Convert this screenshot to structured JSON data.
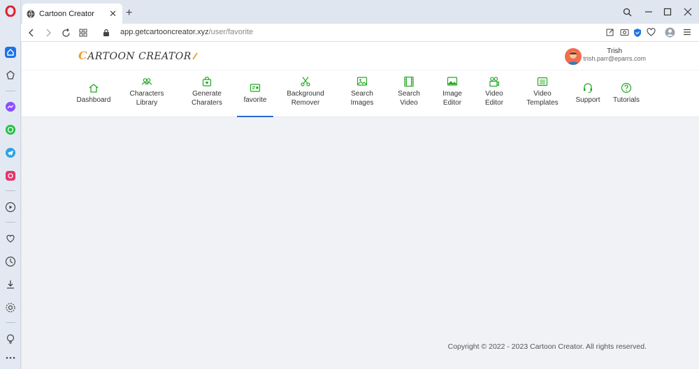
{
  "browser": {
    "tab_title": "Cartoon Creator",
    "url_domain": "app.getcartooncreator.xyz",
    "url_path": "/user/favorite"
  },
  "header": {
    "logo_first": "C",
    "logo_text": "ARTOON CREATOR",
    "user_name": "Trish",
    "user_email": "trish.parr@eparrs.com"
  },
  "nav": [
    {
      "label": "Dashboard",
      "icon": "home-icon"
    },
    {
      "label": "Characters\nLibrary",
      "icon": "users-icon"
    },
    {
      "label": "Generate\nCharaters",
      "icon": "bag-icon"
    },
    {
      "label": "favorite",
      "icon": "card-icon"
    },
    {
      "label": "Background\nRemover",
      "icon": "scissors-icon"
    },
    {
      "label": "Search\nImages",
      "icon": "image-icon"
    },
    {
      "label": "Search\nVideo",
      "icon": "film-icon"
    },
    {
      "label": "Image\nEditor",
      "icon": "image-edit-icon"
    },
    {
      "label": "Video\nEditor",
      "icon": "camera-icon"
    },
    {
      "label": "Video\nTemplates",
      "icon": "template-icon"
    },
    {
      "label": "Support",
      "icon": "headset-icon"
    },
    {
      "label": "Tutorials",
      "icon": "help-icon"
    }
  ],
  "footer": {
    "text": "Copyright © 2022 - 2023 Cartoon Creator. All rights reserved."
  },
  "colors": {
    "accent_green": "#22a822",
    "active_underline": "#2a6acf",
    "page_bg": "#f0f2f6"
  }
}
